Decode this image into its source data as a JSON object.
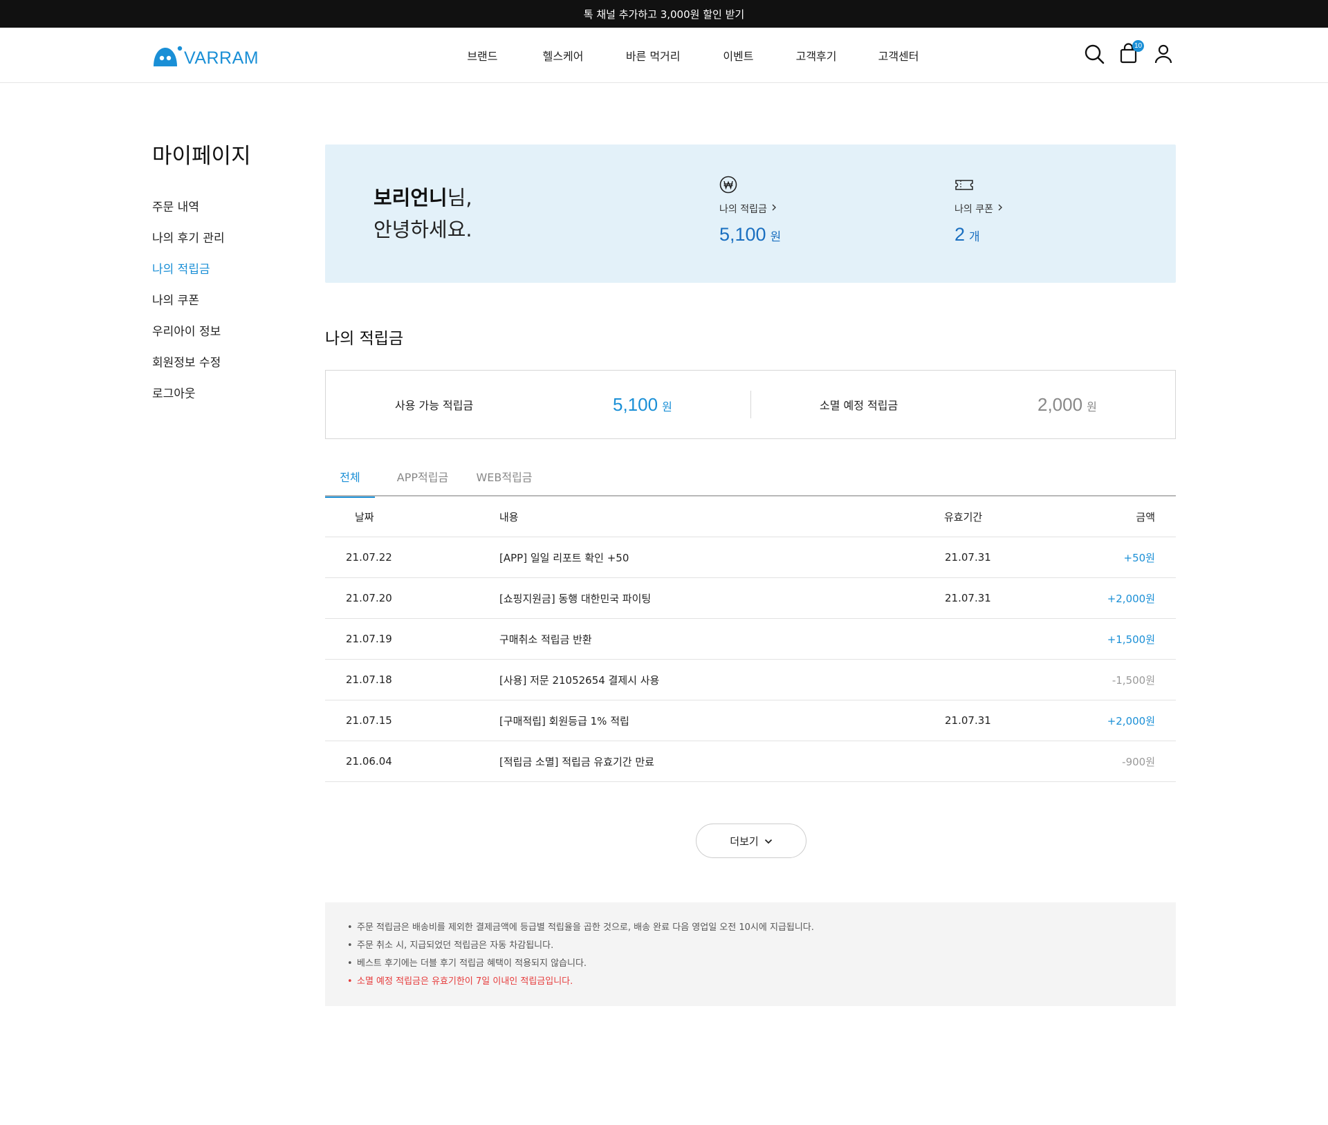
{
  "promo": {
    "text": "톡 채널 추가하고 3,000원 할인 받기"
  },
  "header": {
    "logo_text": "VARRAM",
    "nav": [
      "브랜드",
      "헬스케어",
      "바른 먹거리",
      "이벤트",
      "고객후기",
      "고객센터"
    ],
    "cart_count": "10",
    "colors": {
      "accent": "#1a8fd6",
      "value": "#1a6fc0"
    }
  },
  "sidebar": {
    "title": "마이페이지",
    "items": [
      {
        "label": "주문 내역"
      },
      {
        "label": "나의 후기 관리"
      },
      {
        "label": "나의 적립금",
        "active": true
      },
      {
        "label": "나의 쿠폰"
      },
      {
        "label": "우리아이 정보"
      },
      {
        "label": "회원정보 수정"
      },
      {
        "label": "로그아웃"
      }
    ]
  },
  "welcome": {
    "name": "보리언니",
    "suffix": "님,",
    "greeting": "안녕하세요.",
    "points": {
      "label": "나의 적립금",
      "value": "5,100",
      "unit": "원"
    },
    "coupons": {
      "label": "나의 쿠폰",
      "value": "2",
      "unit": "개"
    }
  },
  "section": {
    "title": "나의 적립금"
  },
  "summary": {
    "available_label": "사용 가능 적립금",
    "available_value": "5,100",
    "available_unit": "원",
    "expiring_label": "소멸 예정 적립금",
    "expiring_value": "2,000",
    "expiring_unit": "원"
  },
  "tabs": [
    "전체",
    "APP적립금",
    "WEB적립금"
  ],
  "table": {
    "headers": {
      "date": "날짜",
      "desc": "내용",
      "expiry": "유효기간",
      "amount": "금액"
    },
    "rows": [
      {
        "date": "21.07.22",
        "desc": "[APP] 일일 리포트 확인 +50",
        "expiry": "21.07.31",
        "amount": "+50원",
        "sign": "plus"
      },
      {
        "date": "21.07.20",
        "desc": "[쇼핑지원금] 동행 대한민국 파이팅",
        "expiry": "21.07.31",
        "amount": "+2,000원",
        "sign": "plus"
      },
      {
        "date": "21.07.19",
        "desc": "구매취소 적립금 반환",
        "expiry": "",
        "amount": "+1,500원",
        "sign": "plus"
      },
      {
        "date": "21.07.18",
        "desc": "[사용] 저문 21052654 결제시 사용",
        "expiry": "",
        "amount": "-1,500원",
        "sign": "minus"
      },
      {
        "date": "21.07.15",
        "desc": "[구매적립] 회원등급 1% 적립",
        "expiry": "21.07.31",
        "amount": "+2,000원",
        "sign": "plus"
      },
      {
        "date": "21.06.04",
        "desc": "[적립금 소멸] 적립금 유효기간 만료",
        "expiry": "",
        "amount": "-900원",
        "sign": "minus"
      }
    ]
  },
  "more_button": {
    "label": "더보기"
  },
  "notes": [
    {
      "text": "주문 적립금은 배송비를 제외한 결제금액에 등급별 적립율을 곱한 것으로, 배송 완료 다음 영업일 오전 10시에 지급됩니다."
    },
    {
      "text": "주문 취소 시, 지급되었던 적립금은 자동 차감됩니다."
    },
    {
      "text": "베스트 후기에는 더블 후기 적립금 혜택이 적용되지 않습니다."
    },
    {
      "text": "소멸 예정 적립금은 유효기한이 7일 이내인 적립금입니다.",
      "warn": true
    }
  ]
}
